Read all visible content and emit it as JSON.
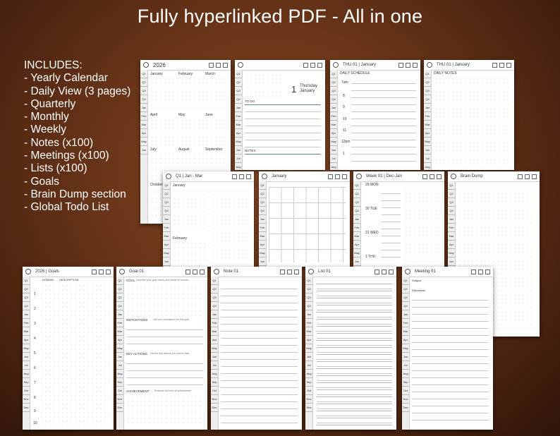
{
  "header": {
    "title": "Fully hyperlinked PDF - All in one"
  },
  "includes": {
    "heading": "INCLUDES:",
    "items": [
      "- Yearly Calendar",
      "- Daily View (3 pages)",
      "- Quarterly",
      "- Monthly",
      "- Weekly",
      "- Notes (x100)",
      "- Meetings (x100)",
      "- Lists (x100)",
      "- Goals",
      "- Brain Dump section",
      "- Global Todo List"
    ]
  },
  "pages": {
    "yearly": {
      "title": "2026",
      "months": [
        "January",
        "February",
        "March",
        "April",
        "May",
        "June",
        "July",
        "August",
        "September",
        "October"
      ]
    },
    "daily1": {
      "day_num": "1",
      "day_name": "Thursday",
      "month": "January",
      "todo": "TO DO",
      "notes": "NOTES"
    },
    "daily2": {
      "title": "THU  01 | January",
      "section": "DAILY SCHEDULE",
      "times": [
        "7am",
        "8",
        "9",
        "10",
        "11",
        "12pm",
        "1"
      ]
    },
    "daily3": {
      "title": "THU  01 | January",
      "section": "DAILY NOTES"
    },
    "quarterly": {
      "title": "Q1 | Jan - Mar",
      "months": [
        "January",
        "February"
      ]
    },
    "monthly": {
      "title": "January"
    },
    "weekly": {
      "title": "Week 01 | Dec-Jan",
      "days": [
        "29 MON",
        "30 TUE",
        "31 WED",
        "1 THU"
      ]
    },
    "braindump": {
      "title": "Brain Dump"
    },
    "goals": {
      "title": "2026 | Goals",
      "col1": "DOMAIN",
      "col2": "DESCRIPTION",
      "rows": [
        "1",
        "2",
        "3",
        "4",
        "5",
        "6",
        "7",
        "8",
        "9",
        "10"
      ]
    },
    "goal": {
      "title": "Goal  01",
      "goal_label": "GOAL",
      "goal_hint": "Describe your goal clearly and define its domain",
      "motivations": "MOTIVATIONS",
      "motivations_hint": "List your motivations for this goal",
      "key_actions": "KEY ACTIONS",
      "key_actions_hint": "List the key actions you plan to take",
      "achievement": "ACHIEVEMENT",
      "achievement_hint": "Evaluate the level of achievement"
    },
    "note": {
      "title": "Note  01"
    },
    "list": {
      "title": "List  01"
    },
    "meeting": {
      "title": "Meeting  01",
      "subject": "Subject",
      "discussion": "Discussion"
    }
  },
  "side_tabs": [
    "Q1",
    "Q2",
    "Q3",
    "Q4",
    "Jan",
    "Feb",
    "Mar",
    "Apr",
    "May",
    "Jun",
    "Jul",
    "Aug",
    "Sep",
    "Oct",
    "Nov",
    "Dec"
  ]
}
